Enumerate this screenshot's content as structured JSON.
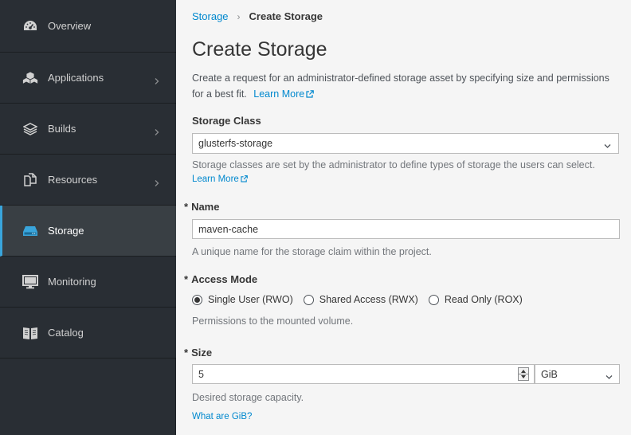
{
  "sidebar": {
    "items": [
      {
        "label": "Overview",
        "icon": "dashboard-icon",
        "has_chevron": false,
        "active": false
      },
      {
        "label": "Applications",
        "icon": "cubes-icon",
        "has_chevron": true,
        "active": false
      },
      {
        "label": "Builds",
        "icon": "layers-icon",
        "has_chevron": true,
        "active": false
      },
      {
        "label": "Resources",
        "icon": "copy-files-icon",
        "has_chevron": true,
        "active": false
      },
      {
        "label": "Storage",
        "icon": "hard-drive-icon",
        "has_chevron": false,
        "active": true
      },
      {
        "label": "Monitoring",
        "icon": "monitor-icon",
        "has_chevron": false,
        "active": false
      },
      {
        "label": "Catalog",
        "icon": "book-icon",
        "has_chevron": false,
        "active": false
      }
    ]
  },
  "breadcrumb": {
    "parent": "Storage",
    "separator": "›",
    "current": "Create Storage"
  },
  "page": {
    "title": "Create Storage",
    "description": "Create a request for an administrator-defined storage asset by specifying size and permissions for a best fit.",
    "learn_more": "Learn More"
  },
  "storage_class": {
    "label": "Storage Class",
    "value": "glusterfs-storage",
    "help": "Storage classes are set by the administrator to define types of storage the users can select.",
    "learn_more": "Learn More"
  },
  "name_field": {
    "required_mark": "*",
    "label": "Name",
    "value": "maven-cache",
    "help": "A unique name for the storage claim within the project."
  },
  "access_mode": {
    "required_mark": "*",
    "label": "Access Mode",
    "options": [
      {
        "label": "Single User (RWO)",
        "selected": true
      },
      {
        "label": "Shared Access (RWX)",
        "selected": false
      },
      {
        "label": "Read Only (ROX)",
        "selected": false
      }
    ],
    "help": "Permissions to the mounted volume."
  },
  "size": {
    "required_mark": "*",
    "label": "Size",
    "value": "5",
    "unit": "GiB",
    "help": "Desired storage capacity.",
    "link": "What are GiB?"
  },
  "colors": {
    "sidebar_bg": "#292e34",
    "active_accent": "#39a5dc",
    "link": "#0088ce"
  }
}
